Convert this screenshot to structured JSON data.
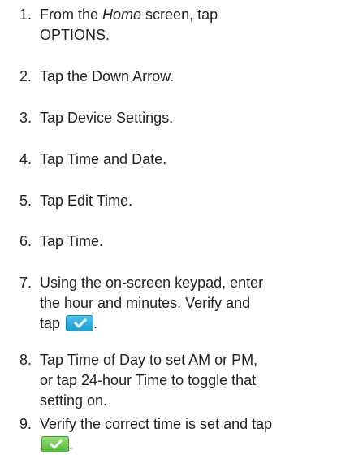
{
  "steps": [
    {
      "num": "1.",
      "parts": [
        {
          "t": "From the "
        },
        {
          "t": "Home",
          "style": "em"
        },
        {
          "t": " screen, tap"
        },
        {
          "t": "OPTIONS",
          "break": true
        },
        {
          "t": "."
        }
      ]
    },
    {
      "num": "2.",
      "parts": [
        {
          "t": "Tap the "
        },
        {
          "t": "Down Arrow"
        },
        {
          "t": "."
        }
      ]
    },
    {
      "num": "3.",
      "parts": [
        {
          "t": "Tap "
        },
        {
          "t": "Device Settings"
        },
        {
          "t": "."
        }
      ]
    },
    {
      "num": "4.",
      "parts": [
        {
          "t": "Tap "
        },
        {
          "t": "Time and Date"
        },
        {
          "t": "."
        }
      ]
    },
    {
      "num": "5.",
      "parts": [
        {
          "t": "Tap "
        },
        {
          "t": "Edit Time"
        },
        {
          "t": "."
        }
      ]
    },
    {
      "num": "6.",
      "parts": [
        {
          "t": "Tap "
        },
        {
          "t": "Time"
        },
        {
          "t": "."
        }
      ]
    },
    {
      "num": "7.",
      "line1": "Using the on-screen keypad, enter",
      "line2": "the hour and minutes. Verify and",
      "line3": "tap",
      "icon": "checkmark-button-blue"
    },
    {
      "num": "8.",
      "line1": "Tap Time of Day to set AM or PM,",
      "line2": "or tap 24-hour Time to toggle that",
      "line3": "setting on."
    },
    {
      "num": "9.",
      "line1": "Verify the correct time is set and tap",
      "icon": "checkmark-button-green"
    }
  ]
}
